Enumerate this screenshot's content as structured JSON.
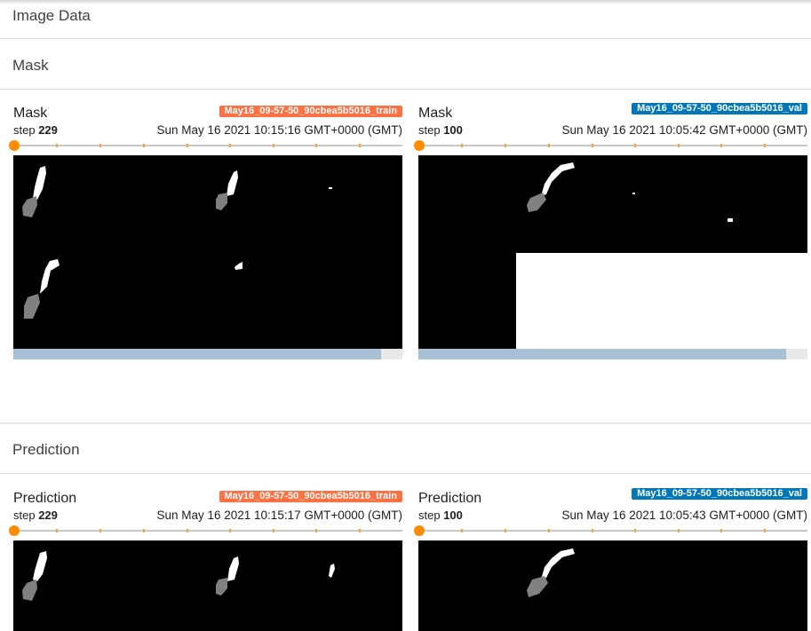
{
  "header": {
    "title": "Image Data"
  },
  "sections": [
    {
      "title": "Mask",
      "cards": [
        {
          "title": "Mask",
          "step_label": "step",
          "step": "229",
          "run": "May16_09-57-50_90cbea5b5016_train",
          "run_color": "#ff7043",
          "time": "Sun May 16 2021 10:15:16 GMT+0000 (GMT)",
          "scroll_fraction": 0.945
        },
        {
          "title": "Mask",
          "step_label": "step",
          "step": "100",
          "run": "May16_09-57-50_90cbea5b5016_val",
          "run_color": "#0077bb",
          "time": "Sun May 16 2021 10:05:42 GMT+0000 (GMT)",
          "scroll_fraction": 0.945
        }
      ]
    },
    {
      "title": "Prediction",
      "cards": [
        {
          "title": "Prediction",
          "step_label": "step",
          "step": "229",
          "run": "May16_09-57-50_90cbea5b5016_train",
          "run_color": "#ff7043",
          "time": "Sun May 16 2021 10:15:17 GMT+0000 (GMT)"
        },
        {
          "title": "Prediction",
          "step_label": "step",
          "step": "100",
          "run": "May16_09-57-50_90cbea5b5016_val",
          "run_color": "#0077bb",
          "time": "Sun May 16 2021 10:05:43 GMT+0000 (GMT)"
        }
      ]
    }
  ],
  "colors": {
    "slider_thumb": "#ff8c00",
    "tick": "#f4a340",
    "scroll_fill": "#a7c0d6"
  }
}
